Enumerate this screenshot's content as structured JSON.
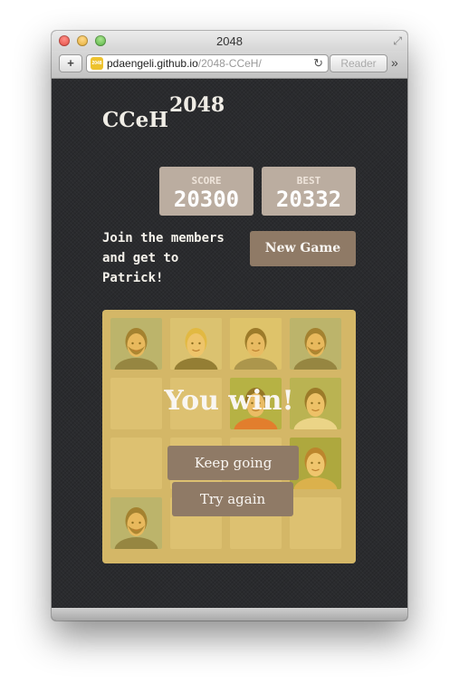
{
  "window": {
    "title": "2048"
  },
  "toolbar": {
    "add_label": "+",
    "url_host": "pdaengeli.github.io",
    "url_path": "/2048-CCeH/",
    "reload_glyph": "↻",
    "reader_label": "Reader",
    "more_glyph": "»",
    "favicon_text": "2048"
  },
  "game": {
    "logo": "CCeH",
    "logo_sup": "2048",
    "score_label": "SCORE",
    "score_value": "20300",
    "best_label": "BEST",
    "best_value": "20332",
    "intro": "Join the members and get to Patrick!",
    "new_game_label": "New Game",
    "win_message": "You win!",
    "keep_going_label": "Keep going",
    "try_again_label": "Try again"
  },
  "colors": {
    "board": "#bbada0",
    "win_overlay": "#edc22e",
    "button": "#8f7a66",
    "page_bg": "#2a2b2e"
  },
  "board": {
    "rows": [
      [
        "face-man-beard",
        "face-woman-blonde",
        "face-man-young",
        "face-man-beard"
      ],
      [
        "",
        "",
        "face-man-redshirt",
        "face-man-smiling"
      ],
      [
        "",
        "",
        "",
        "face-woman-curly"
      ],
      [
        "face-man-beard",
        "",
        "",
        ""
      ]
    ]
  }
}
